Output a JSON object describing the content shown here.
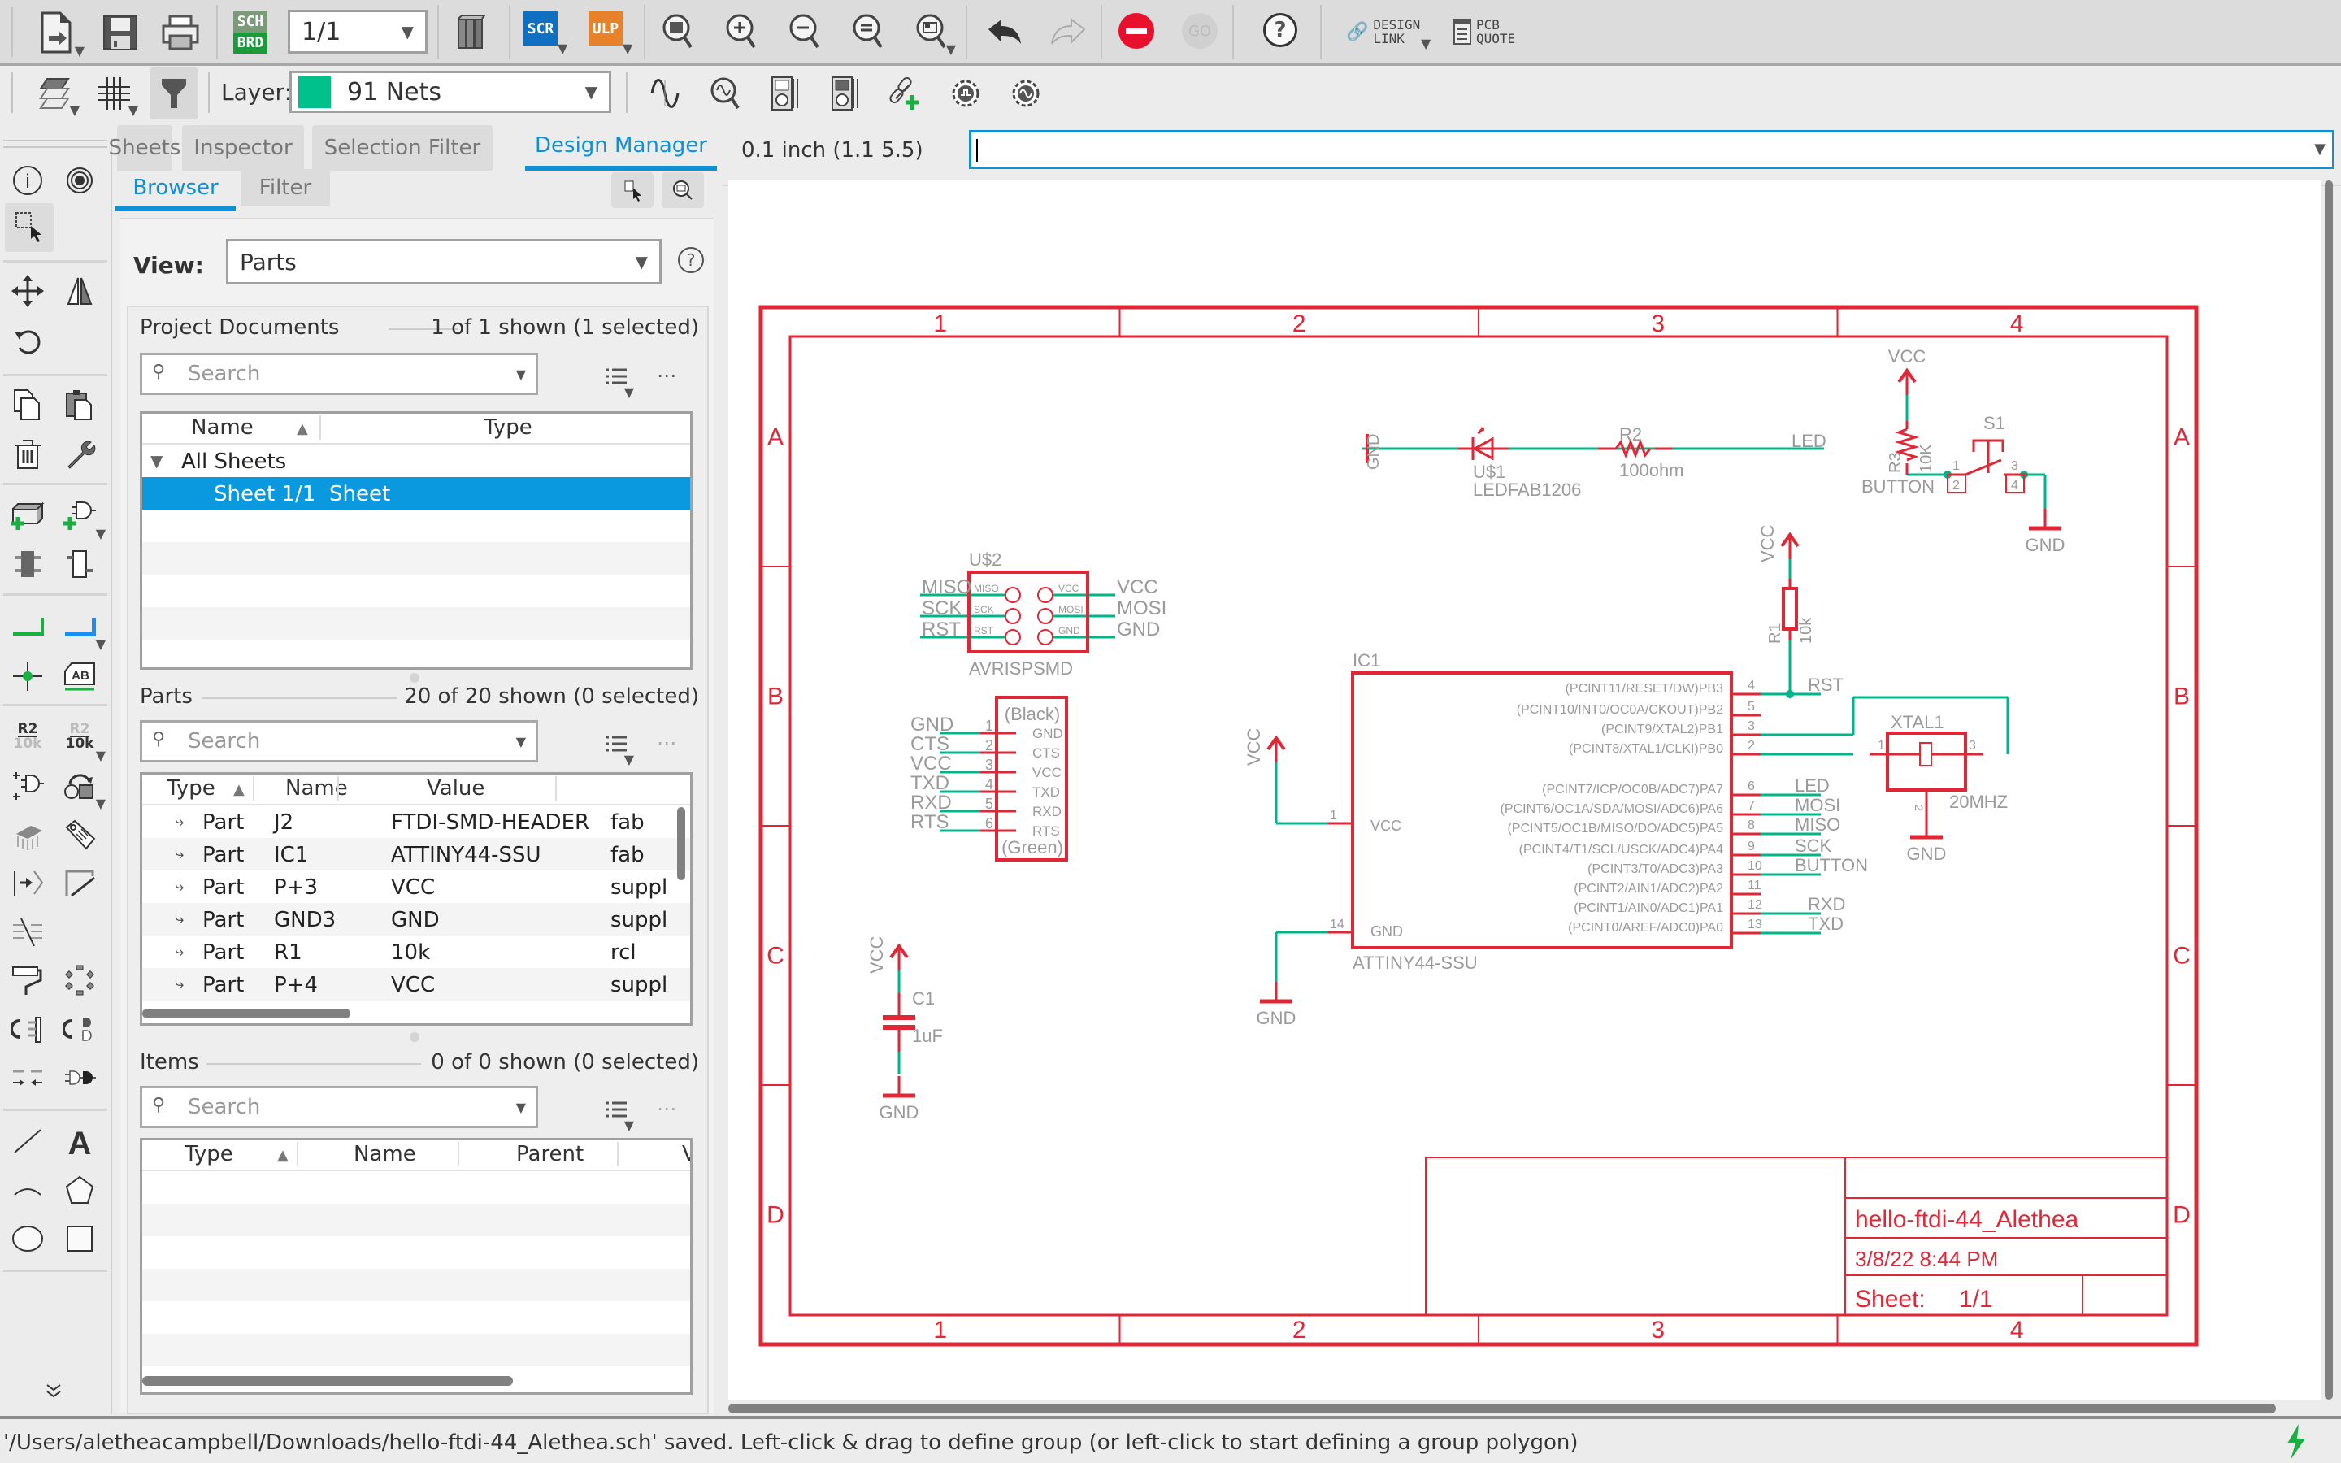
{
  "toolbar_top": {
    "sheet_selector": {
      "value": "1/1"
    },
    "sch_brd_label": [
      "SCH",
      "BRD"
    ],
    "scr_label": "SCR",
    "ulp_label": "ULP",
    "go_label": "GO",
    "design_link_label": [
      "DESIGN",
      "LINK"
    ],
    "pcb_quote_label": [
      "PCB",
      "QUOTE"
    ],
    "icons": [
      "open-icon",
      "save-icon",
      "print-icon",
      "sch-brd-switch-icon",
      "library-icon",
      "script-icon",
      "ulp-icon",
      "zoom-fit-icon",
      "zoom-in-icon",
      "zoom-out-icon",
      "zoom-redraw-icon",
      "zoom-select-icon",
      "undo-icon",
      "redo-icon",
      "stop-icon",
      "go-icon",
      "help-icon",
      "design-link-icon",
      "pcb-quote-icon"
    ]
  },
  "toolbar_second": {
    "layer_label": "Layer:",
    "layer_value": "91 Nets",
    "layer_color": "#00c08b",
    "icons": [
      "layer-settings-icon",
      "grid-icon",
      "filter-icon",
      "simulate-icon",
      "probe-icon",
      "meter-icon",
      "meter-ac-icon",
      "link-add-icon",
      "gear-sim-icon",
      "gear-ac-icon"
    ]
  },
  "panel": {
    "tabs": [
      {
        "label": "Sheets",
        "active": false
      },
      {
        "label": "Inspector",
        "active": false
      },
      {
        "label": "Selection Filter",
        "active": false
      },
      {
        "label": "Design Manager",
        "active": true
      }
    ],
    "subtabs": [
      {
        "label": "Browser",
        "active": true
      },
      {
        "label": "Filter",
        "active": false
      }
    ],
    "view_label": "View:",
    "view_value": "Parts",
    "project_documents": {
      "title": "Project Documents",
      "count": "1 of 1 shown (1 selected)",
      "search_placeholder": "Search",
      "columns": [
        "Name",
        "Type"
      ],
      "group": "All Sheets",
      "rows": [
        {
          "name": "Sheet 1/1",
          "type": "Sheet",
          "selected": true
        }
      ]
    },
    "parts": {
      "title": "Parts",
      "count": "20 of 20 shown (0 selected)",
      "search_placeholder": "Search",
      "columns": [
        "Type",
        "Name",
        "Value",
        ""
      ],
      "rows": [
        {
          "type": "Part",
          "name": "J2",
          "value": "FTDI-SMD-HEADER",
          "lib": "fab"
        },
        {
          "type": "Part",
          "name": "IC1",
          "value": "ATTINY44-SSU",
          "lib": "fab"
        },
        {
          "type": "Part",
          "name": "P+3",
          "value": "VCC",
          "lib": "suppl"
        },
        {
          "type": "Part",
          "name": "GND3",
          "value": "GND",
          "lib": "suppl"
        },
        {
          "type": "Part",
          "name": "R1",
          "value": "10k",
          "lib": "rcl"
        },
        {
          "type": "Part",
          "name": "P+4",
          "value": "VCC",
          "lib": "suppl"
        }
      ]
    },
    "items": {
      "title": "Items",
      "count": "0 of 0 shown (0 selected)",
      "search_placeholder": "Search",
      "columns": [
        "Type",
        "Name",
        "Parent",
        "V"
      ]
    }
  },
  "command": {
    "grid_readout": "0.1 inch (1.1 5.5)",
    "input_value": ""
  },
  "schematic": {
    "frame_cols": [
      "1",
      "2",
      "3",
      "4"
    ],
    "frame_rows": [
      "A",
      "B",
      "C",
      "D"
    ],
    "title_block": {
      "title": "hello-ftdi-44_Alethea",
      "date": "3/8/22 8:44 PM",
      "sheet_label": "Sheet:",
      "sheet_value": "1/1"
    },
    "parts": {
      "u2": {
        "name": "U$2",
        "value": "AVRISPSMD",
        "pins_left": [
          "MISO",
          "SCK",
          "RST"
        ],
        "pins_right": [
          "VCC",
          "MOSI",
          "GND"
        ],
        "inner_left": [
          "MISO",
          "SCK",
          "RST"
        ],
        "inner_right": [
          "VCC",
          "MOSI",
          "GND"
        ]
      },
      "j2": {
        "top": "(Black)",
        "bottom": "(Green)",
        "pins": [
          "GND",
          "CTS",
          "VCC",
          "TXD",
          "RXD",
          "RTS"
        ],
        "nums": [
          "1",
          "2",
          "3",
          "4",
          "5",
          "6"
        ],
        "nets": [
          "GND",
          "CTS",
          "VCC",
          "TXD",
          "RXD",
          "RTS"
        ]
      },
      "ic1": {
        "name": "IC1",
        "value": "ATTINY44-SSU",
        "pins_right": [
          {
            "num": "4",
            "label": "(PCINT11/RESET/DW)PB3",
            "net": "RST"
          },
          {
            "num": "5",
            "label": "(PCINT10/INT0/OC0A/CKOUT)PB2",
            "net": ""
          },
          {
            "num": "3",
            "label": "(PCINT9/XTAL2)PB1",
            "net": ""
          },
          {
            "num": "2",
            "label": "(PCINT8/XTAL1/CLKI)PB0",
            "net": ""
          },
          {
            "num": "6",
            "label": "(PCINT7/ICP/OC0B/ADC7)PA7",
            "net": "LED"
          },
          {
            "num": "7",
            "label": "(PCINT6/OC1A/SDA/MOSI/ADC6)PA6",
            "net": "MOSI"
          },
          {
            "num": "8",
            "label": "(PCINT5/OC1B/MISO/DO/ADC5)PA5",
            "net": "MISO"
          },
          {
            "num": "9",
            "label": "(PCINT4/T1/SCL/USCK/ADC4)PA4",
            "net": "SCK"
          },
          {
            "num": "10",
            "label": "(PCINT3/T0/ADC3)PA3",
            "net": "BUTTON"
          },
          {
            "num": "11",
            "label": "(PCINT2/AIN1/ADC2)PA2",
            "net": ""
          },
          {
            "num": "12",
            "label": "(PCINT1/AIN0/ADC1)PA1",
            "net": "RXD"
          },
          {
            "num": "13",
            "label": "(PCINT0/AREF/ADC0)PA0",
            "net": "TXD"
          }
        ],
        "vcc_label": "VCC",
        "gnd_label": "GND",
        "vcc_pin": "1",
        "gnd_pin": "14"
      },
      "u1": {
        "name": "U$1",
        "value": "LEDFAB1206"
      },
      "r2": {
        "name": "R2",
        "value": "100ohm",
        "net": "LED"
      },
      "r1": {
        "name": "R1",
        "value": "10k"
      },
      "r3": {
        "name": "R3",
        "value": "10K"
      },
      "s1": {
        "name": "S1",
        "net": "BUTTON",
        "pins": [
          "1",
          "2",
          "3",
          "4"
        ]
      },
      "xtal1": {
        "name": "XTAL1",
        "value": "20MHZ",
        "pins": [
          "1",
          "2",
          "3"
        ]
      },
      "c1": {
        "name": "C1",
        "value": "1uF"
      },
      "supply": {
        "vcc": "VCC",
        "gnd": "GND"
      }
    }
  },
  "status": {
    "message": "'/Users/aletheacampbell/Downloads/hello-ftdi-44_Alethea.sch' saved. Left-click & drag to define group (or left-click to start defining a group polygon)"
  },
  "colors": {
    "accent": "#0f8fd4",
    "schematic_red": "#e32636",
    "net_green": "#00b58a",
    "text_gray": "#9a9a9a",
    "selection": "#0a98de"
  }
}
